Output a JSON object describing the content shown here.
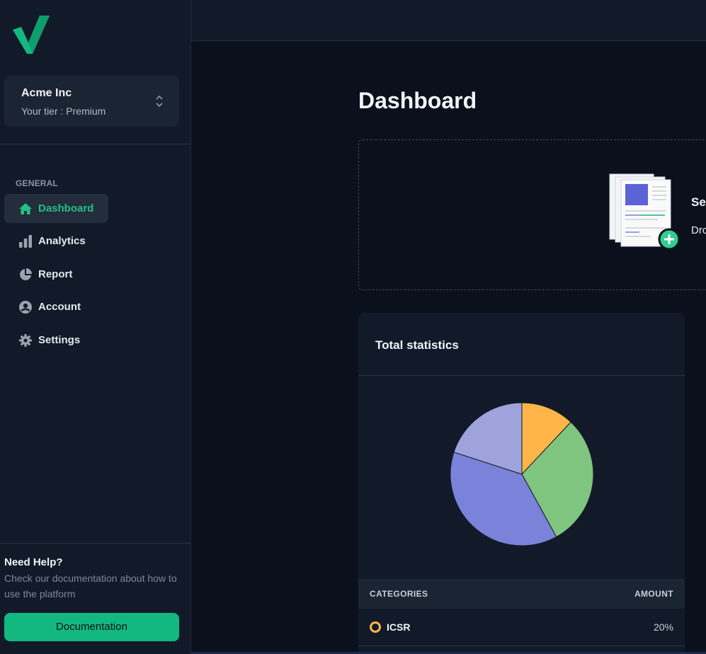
{
  "org": {
    "name": "Acme Inc",
    "tier": "Your tier : Premium"
  },
  "nav": {
    "section_title": "GENERAL",
    "items": [
      {
        "label": "Dashboard",
        "icon": "home-icon",
        "active": true
      },
      {
        "label": "Analytics",
        "icon": "bar-chart-icon",
        "active": false
      },
      {
        "label": "Report",
        "icon": "pie-chart-icon",
        "active": false
      },
      {
        "label": "Account",
        "icon": "user-circle-icon",
        "active": false
      },
      {
        "label": "Settings",
        "icon": "gear-icon",
        "active": false
      }
    ]
  },
  "help": {
    "title": "Need Help?",
    "text": "Check our documentation about how to use the platform",
    "button_label": "Documentation"
  },
  "page": {
    "title": "Dashboard"
  },
  "dropzone": {
    "title": "Se",
    "subtitle": "Dro"
  },
  "stats": {
    "title": "Total statistics",
    "table": {
      "headers": [
        "CATEGORIES",
        "AMOUNT"
      ],
      "rows": [
        {
          "category": "ICSR",
          "amount": "20%",
          "color": "#ffb547"
        }
      ]
    }
  },
  "chart_data": {
    "type": "pie",
    "title": "",
    "slices": [
      {
        "name": "ICSR",
        "value": 12,
        "color": "#ffb547"
      },
      {
        "name": "",
        "value": 30,
        "color": "#7fc47f"
      },
      {
        "name": "",
        "value": 38,
        "color": "#7b82d9"
      },
      {
        "name": "",
        "value": 20,
        "color": "#9ea3dc"
      }
    ]
  },
  "colors": {
    "accent": "#12b880",
    "background": "#0b111c",
    "panel": "#121a29"
  }
}
